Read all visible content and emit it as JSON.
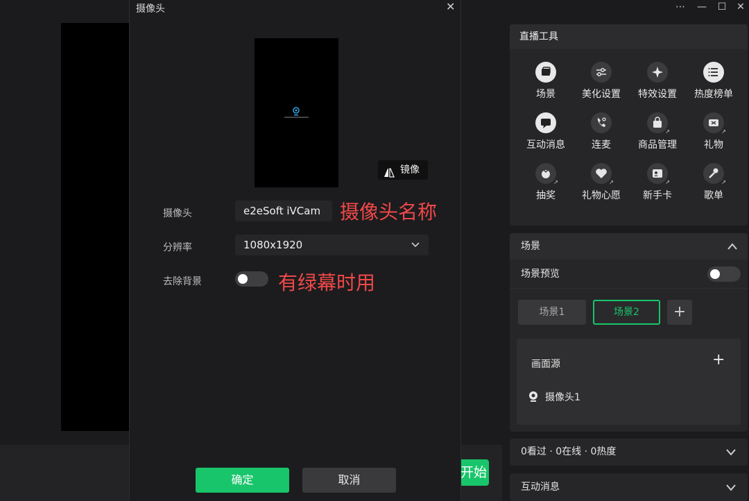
{
  "main": {
    "start_button_label": "开始"
  },
  "window": {
    "more": "⋯",
    "minimize": "—",
    "maximize": "☐",
    "close": "✕"
  },
  "tools_panel": {
    "title": "直播工具",
    "items": [
      {
        "label": "场景",
        "icon": "scene-icon"
      },
      {
        "label": "美化设置",
        "icon": "sliders-icon"
      },
      {
        "label": "特效设置",
        "icon": "sparkle-icon"
      },
      {
        "label": "热度榜单",
        "icon": "list-icon"
      },
      {
        "label": "互动消息",
        "icon": "chat-icon"
      },
      {
        "label": "连麦",
        "icon": "phone-icon"
      },
      {
        "label": "商品管理",
        "icon": "shopping-bag-icon"
      },
      {
        "label": "礼物",
        "icon": "gift-icon"
      },
      {
        "label": "抽奖",
        "icon": "lottery-icon"
      },
      {
        "label": "礼物心愿",
        "icon": "heart-wish-icon"
      },
      {
        "label": "新手卡",
        "icon": "card-icon"
      },
      {
        "label": "歌单",
        "icon": "microphone-icon"
      }
    ]
  },
  "scene_panel": {
    "title": "场景",
    "preview_label": "场景预览",
    "scenes": [
      "场景1",
      "场景2"
    ],
    "source_title": "画面源",
    "sources": [
      {
        "label": "摄像头1",
        "icon": "camera-icon"
      }
    ]
  },
  "stats": {
    "text": "0看过 · 0在线 · 0热度"
  },
  "messages": {
    "title": "互动消息"
  },
  "dialog": {
    "title": "摄像头",
    "mirror_label": "镜像",
    "camera_label": "摄像头",
    "camera_value": "e2eSoft iVCam",
    "resolution_label": "分辨率",
    "resolution_value": "1080x1920",
    "remove_bg_label": "去除背景",
    "remove_bg_on": false,
    "annotation_camera": "摄像头名称",
    "annotation_bg": "有绿幕时用",
    "ok_label": "确定",
    "cancel_label": "取消"
  },
  "colors": {
    "accent": "#19c56b",
    "annotation": "#f04848",
    "panel": "#262628"
  }
}
